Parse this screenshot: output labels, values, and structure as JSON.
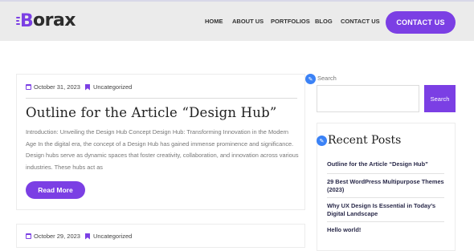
{
  "brand": {
    "logo_letter": "B",
    "logo_rest": "orax",
    "accent": "#7b3fe4"
  },
  "nav": {
    "home": "HOME",
    "about": "ABOUT US",
    "portfolios": "PORTFOLIOS",
    "blog": "BLOG",
    "contact": "CONTACT US"
  },
  "header_button": "CONTACT US",
  "posts": [
    {
      "date": "October 31, 2023",
      "category": "Uncategorized",
      "title": "Outline for the Article “Design Hub”",
      "excerpt": "Introduction: Unveiling the Design Hub Concept Design Hub: Transforming Innovation in the Modern Age In the digital era, the concept of a Design Hub has gained immense prominence and significance. Design hubs serve as dynamic spaces that foster creativity, collaboration, and innovation across various industries. These hubs act as",
      "read_more": "Read More"
    },
    {
      "date": "October 29, 2023",
      "category": "Uncategorized"
    }
  ],
  "sidebar": {
    "search_label": "Search",
    "search_value": "",
    "search_button": "Search",
    "recent_title": "Recent Posts",
    "recent": [
      "Outline for the Article “Design Hub”",
      "29 Best WordPress Multipurpose Themes (2023)",
      "Why UX Design Is Essential in Today’s Digital Landscape",
      "Hello world!"
    ]
  }
}
